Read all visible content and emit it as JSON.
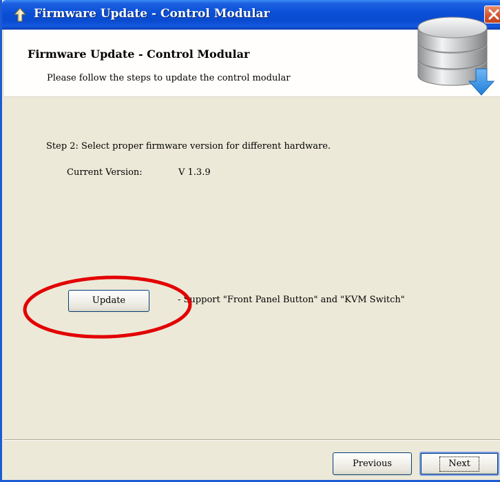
{
  "window": {
    "title": "Firmware Update - Control Modular"
  },
  "header": {
    "title": "Firmware Update - Control Modular",
    "subtitle": "Please follow the steps to update the control modular",
    "icon": "database-download-icon"
  },
  "body": {
    "step_text": "Step 2: Select proper firmware version for different hardware.",
    "current_version_label": "Current Version:",
    "current_version_value": "V 1.3.9",
    "update_button_label": "Update",
    "support_text": "- Support \"Front Panel Button\" and \"KVM Switch\""
  },
  "footer": {
    "previous_label": "Previous",
    "next_label": "Next"
  },
  "colors": {
    "titlebar": "#0a4fd6",
    "window_bg": "#ece9d8",
    "header_bg": "#fffefc",
    "highlight": "#e30000",
    "close_button": "#d75a35"
  }
}
